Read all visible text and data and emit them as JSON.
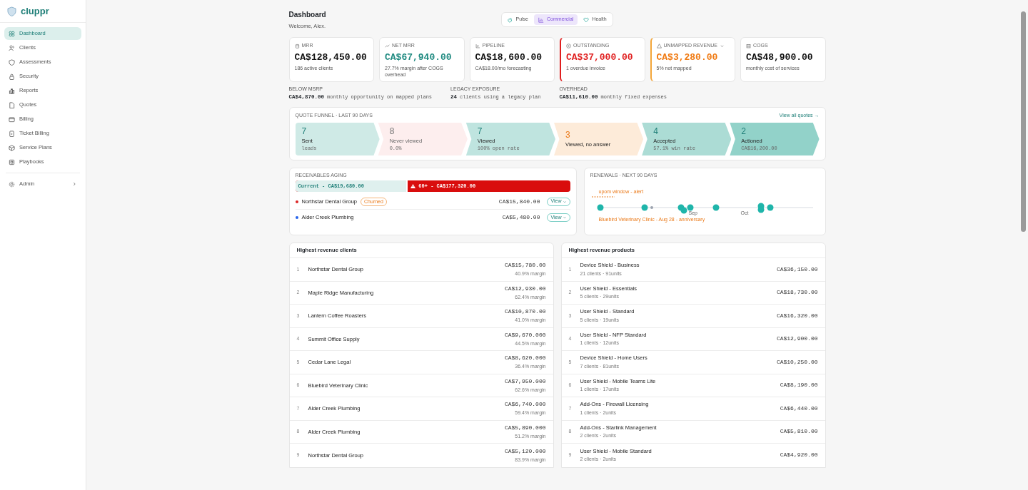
{
  "sidebar": {
    "brand": "cluppr",
    "items": [
      {
        "label": "Dashboard",
        "selected": true
      },
      {
        "label": "Clients",
        "selected": false
      },
      {
        "label": "Assessments",
        "selected": false
      },
      {
        "label": "Security",
        "selected": false
      },
      {
        "label": "Reports",
        "selected": false
      },
      {
        "label": "Quotes",
        "selected": false
      },
      {
        "label": "Billing",
        "selected": false
      },
      {
        "label": "Ticket Billing",
        "selected": false
      },
      {
        "label": "Service Plans",
        "selected": false
      },
      {
        "label": "Playbooks",
        "selected": false
      }
    ],
    "footer_item": {
      "label": "Admin",
      "selected": false
    }
  },
  "header": {
    "title": "Dashboard",
    "subtitle": "Welcome, Alex."
  },
  "view_tabs": [
    {
      "label": "Pulse",
      "selected": false
    },
    {
      "label": "Commercial",
      "selected": true
    },
    {
      "label": "Health",
      "selected": false
    }
  ],
  "kpis": [
    {
      "label": "MRR",
      "value": "CA$128,450.00",
      "note": "186 active clients",
      "kind": "plain",
      "dropdown": false
    },
    {
      "label": "NET MRR",
      "value": "CA$67,940.00",
      "note": "27.7% margin after COGS overhead",
      "kind": "positive",
      "dropdown": false
    },
    {
      "label": "PIPELINE",
      "value": "CA$18,600.00",
      "note": "CA$18.00/mo forecasting",
      "kind": "plain",
      "dropdown": false
    },
    {
      "label": "OUTSTANDING",
      "value": "CA$37,000.00",
      "note": "1 overdue invoice",
      "kind": "danger",
      "dropdown": false
    },
    {
      "label": "UNMAPPED REVENUE",
      "value": "CA$3,280.00",
      "note": "5% not mapped",
      "kind": "warning",
      "dropdown": true
    },
    {
      "label": "COGS",
      "value": "CA$48,900.00",
      "note": "monthly cost of services",
      "kind": "plain",
      "dropdown": false
    }
  ],
  "stats": [
    {
      "label": "BELOW MSRP",
      "value": "CA$4,870.00",
      "note": "monthly opportunity on mapped plans"
    },
    {
      "label": "LEGACY EXPOSURE",
      "value": "24",
      "note": "clients using a legacy plan"
    },
    {
      "label": "OVERHEAD",
      "value": "CA$11,610.00",
      "note": "monthly fixed expenses"
    }
  ],
  "quote_funnel": {
    "title": "QUOTE FUNNEL · LAST 90 DAYS",
    "link": "View all quotes →",
    "stages": [
      {
        "count": "7",
        "label": "Sent",
        "note": "leads",
        "color": "#cfeae6",
        "kind": "teal"
      },
      {
        "count": "8",
        "label": "Never viewed",
        "note": "0.0%",
        "color": "#fdeeee",
        "kind": "muted"
      },
      {
        "count": "7",
        "label": "Viewed",
        "note": "100% open rate",
        "color": "#bfe4df",
        "kind": "teal"
      },
      {
        "count": "3",
        "label": "Viewed, no answer",
        "color": "#fdebd9",
        "kind": "orange"
      },
      {
        "count": "4",
        "label": "Accepted",
        "note": "57.1% win rate",
        "color": "#acdcd5",
        "kind": "teal"
      },
      {
        "count": "2",
        "label": "Actioned",
        "note": "CA$16,200.00",
        "color": "#92d2c9",
        "kind": "teal"
      }
    ]
  },
  "receivables": {
    "title": "RECEIVABLES AGING",
    "current": {
      "label": "Current - CA$19,680.00",
      "level": 0.41
    },
    "overdue": {
      "label": "60+ - CA$177,320.00"
    },
    "rows": [
      {
        "name": "Northstar Dental Group",
        "badge": "Churned",
        "amount": "CA$15,840.00",
        "action": "View",
        "color": "#dc2626"
      },
      {
        "name": "Alder Creek Plumbing",
        "amount": "CA$5,480.00",
        "action": "View",
        "color": "#2563eb"
      }
    ]
  },
  "renewals": {
    "title": "RENEWALS · NEXT 90 DAYS",
    "alert": "upom window - alert",
    "months": [
      "Sep",
      "Oct"
    ],
    "highlight": "Bluebird Veterinary Clinic - Aug 28 - anniversary"
  },
  "top_clients": {
    "title": "Highest revenue clients",
    "rows": [
      {
        "rank": "1",
        "name": "Northstar Dental Group",
        "amount": "CA$15,780.00",
        "margin": "40.9% margin"
      },
      {
        "rank": "2",
        "name": "Maple Ridge Manufacturing",
        "amount": "CA$12,930.00",
        "margin": "62.4% margin"
      },
      {
        "rank": "3",
        "name": "Lantern Coffee Roasters",
        "amount": "CA$10,870.00",
        "margin": "41.0% margin"
      },
      {
        "rank": "4",
        "name": "Summit Office Supply",
        "amount": "CA$9,670.000",
        "margin": "44.5% margin"
      },
      {
        "rank": "5",
        "name": "Cedar Lane Legal",
        "amount": "CA$8,620.000",
        "margin": "36.4% margin"
      },
      {
        "rank": "6",
        "name": "Bluebird Veterinary Clinic",
        "amount": "CA$7,950.000",
        "margin": "62.6% margin"
      },
      {
        "rank": "7",
        "name": "Alder Creek Plumbing",
        "amount": "CA$6,740.000",
        "margin": "59.4% margin"
      },
      {
        "rank": "8",
        "name": "Alder Creek Plumbing",
        "amount": "CA$5,890.000",
        "margin": "51.2% margin"
      },
      {
        "rank": "9",
        "name": "Northstar Dental Group",
        "amount": "CA$5,120.000",
        "margin": "83.9% margin"
      }
    ]
  },
  "top_products": {
    "title": "Highest revenue products",
    "rows": [
      {
        "rank": "1",
        "name": "Device Shield - Business",
        "detail": "21 clients · 91units",
        "amount": "CA$36,150.00"
      },
      {
        "rank": "2",
        "name": "User Shield - Essentials",
        "detail": "5 clients · 29units",
        "amount": "CA$18,730.00"
      },
      {
        "rank": "3",
        "name": "User Shield - Standard",
        "detail": "5 clients · 19units",
        "amount": "CA$16,320.00"
      },
      {
        "rank": "4",
        "name": "User Shield - NFP Standard",
        "detail": "1 clients · 12units",
        "amount": "CA$12,900.00"
      },
      {
        "rank": "5",
        "name": "Device Shield - Home Users",
        "detail": "7 clients · 81units",
        "amount": "CA$10,250.00"
      },
      {
        "rank": "6",
        "name": "User Shield - Mobile Teams Lite",
        "detail": "1 clients · 17units",
        "amount": "CA$8,190.00"
      },
      {
        "rank": "7",
        "name": "Add-Ons - Firewall Licensing",
        "detail": "1 clients · 2units",
        "amount": "CA$6,440.00"
      },
      {
        "rank": "8",
        "name": "Add-Ons - Starlink Management",
        "detail": "2 clients · 2units",
        "amount": "CA$5,810.00"
      },
      {
        "rank": "9",
        "name": "User Shield - Mobile Standard",
        "detail": "2 clients · 2units",
        "amount": "CA$4,920.00"
      }
    ]
  }
}
